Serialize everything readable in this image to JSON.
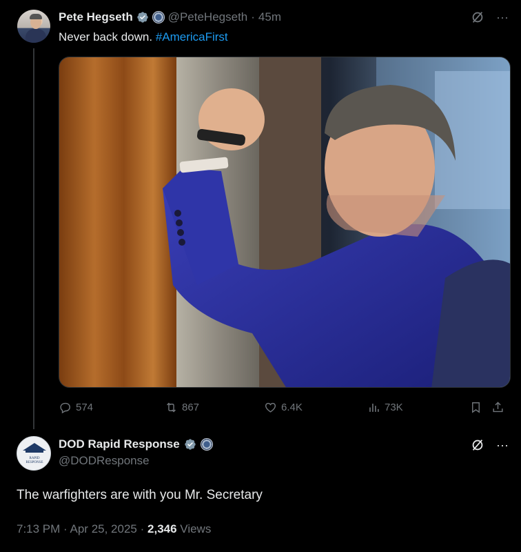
{
  "tweet1": {
    "author_name": "Pete Hegseth",
    "handle": "@PeteHegseth",
    "separator": "·",
    "time": "45m",
    "text": "Never back down.",
    "hashtag": "#AmericaFirst",
    "stats": {
      "replies": "574",
      "reposts": "867",
      "likes": "6.4K",
      "views": "73K"
    }
  },
  "tweet2": {
    "author_name": "DOD Rapid Response",
    "handle": "@DODResponse",
    "avatar_text": "RAPID RESPONSE",
    "text": "The warfighters are with you Mr. Secretary",
    "time": "7:13 PM",
    "separator": "·",
    "date": "Apr 25, 2025",
    "views_count": "2,346",
    "views_label": "Views"
  },
  "icons": {
    "more": "···",
    "verified_color": "#829aab",
    "accent": "#1d9bf0"
  }
}
